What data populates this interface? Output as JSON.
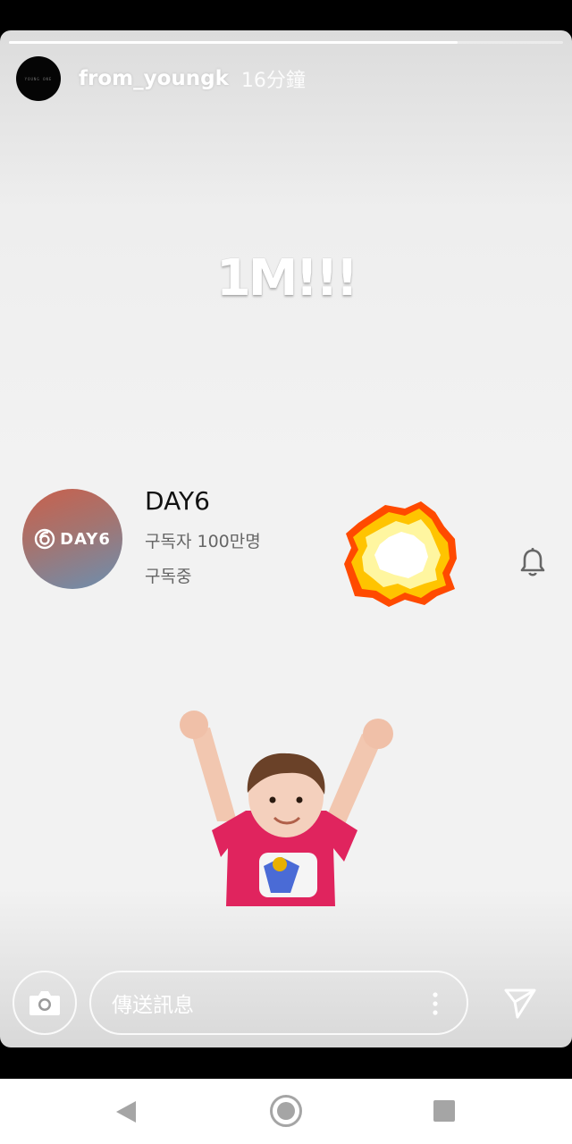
{
  "story": {
    "progress_fraction": 0.81,
    "account": {
      "avatar_text": "YOUNG ONE",
      "username": "from_youngk",
      "time_ago": "16分鐘"
    },
    "headline": "1M!!!",
    "channel_card": {
      "logo_text": "DAY6",
      "name": "DAY6",
      "subscribers": "구독자 100만명",
      "subscription_state": "구독중",
      "accent_colors": [
        "#c9604c",
        "#6b8fb0"
      ]
    },
    "stickers": [
      "explosion-sticker",
      "cheering-kid-sticker"
    ]
  },
  "reply_bar": {
    "camera_icon": "camera-icon",
    "message_placeholder": "傳送訊息",
    "more_icon": "more-vertical-icon",
    "send_icon": "send-icon"
  },
  "system_nav": {
    "back_icon": "back-triangle-icon",
    "home_icon": "home-circle-icon",
    "recents_icon": "recents-square-icon"
  }
}
